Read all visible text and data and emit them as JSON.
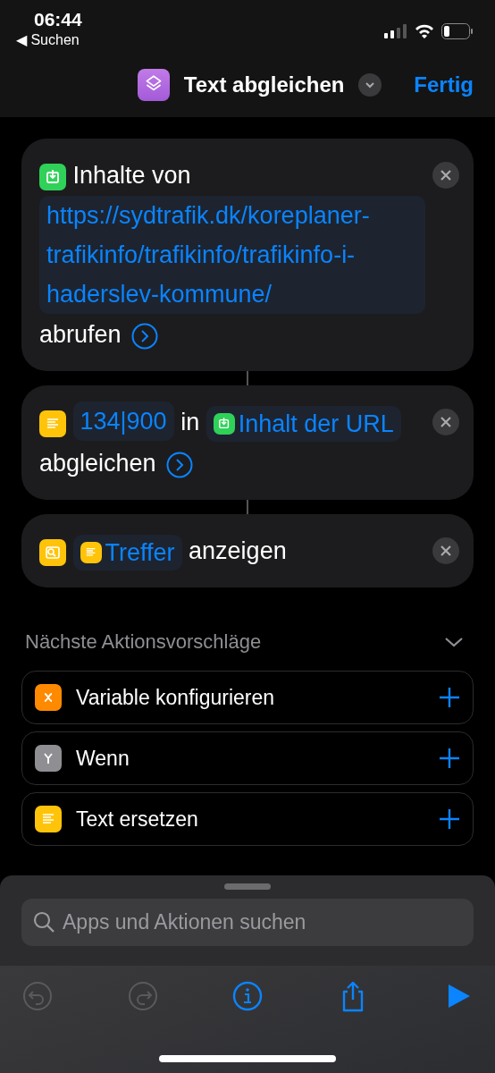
{
  "status_bar": {
    "time": "06:44",
    "back_link": "◀ Suchen"
  },
  "header": {
    "title": "Text abgleichen",
    "done": "Fertig"
  },
  "actions": [
    {
      "kind": "download",
      "expandable": true,
      "parts": [
        {
          "kind": "text",
          "text": "Inhalte von"
        },
        {
          "kind": "param",
          "text": "https://sydtrafik.dk/koreplaner-trafikinfo/trafikinfo/trafikinfo-i-haderslev-kommune/"
        },
        {
          "kind": "text",
          "text": "abrufen"
        }
      ]
    },
    {
      "kind": "text",
      "expandable": true,
      "parts": [
        {
          "kind": "param",
          "text": "134|900"
        },
        {
          "kind": "text",
          "text": "in"
        },
        {
          "kind": "urlvariable",
          "text": "Inhalt der URL"
        },
        {
          "kind": "text",
          "text": "abgleichen"
        }
      ]
    },
    {
      "kind": "quicklook",
      "expandable": false,
      "parts": [
        {
          "kind": "textvariable",
          "text": "Treffer"
        },
        {
          "kind": "text",
          "text": "anzeigen"
        }
      ]
    }
  ],
  "suggestions": {
    "title": "Nächste Aktionsvorschläge",
    "expanded": true,
    "items": [
      {
        "kind": "variable",
        "text": "Variable konfigurieren"
      },
      {
        "kind": "branch",
        "text": "Wenn"
      },
      {
        "kind": "text",
        "text": "Text ersetzen"
      }
    ]
  },
  "search": {
    "placeholder": "Apps und Aktionen suchen"
  },
  "toolbar": [
    {
      "kind": "undo",
      "disabled": true
    },
    {
      "kind": "redo",
      "disabled": true
    },
    {
      "kind": "info",
      "disabled": false
    },
    {
      "kind": "share",
      "disabled": false
    },
    {
      "kind": "play",
      "disabled": false
    }
  ]
}
